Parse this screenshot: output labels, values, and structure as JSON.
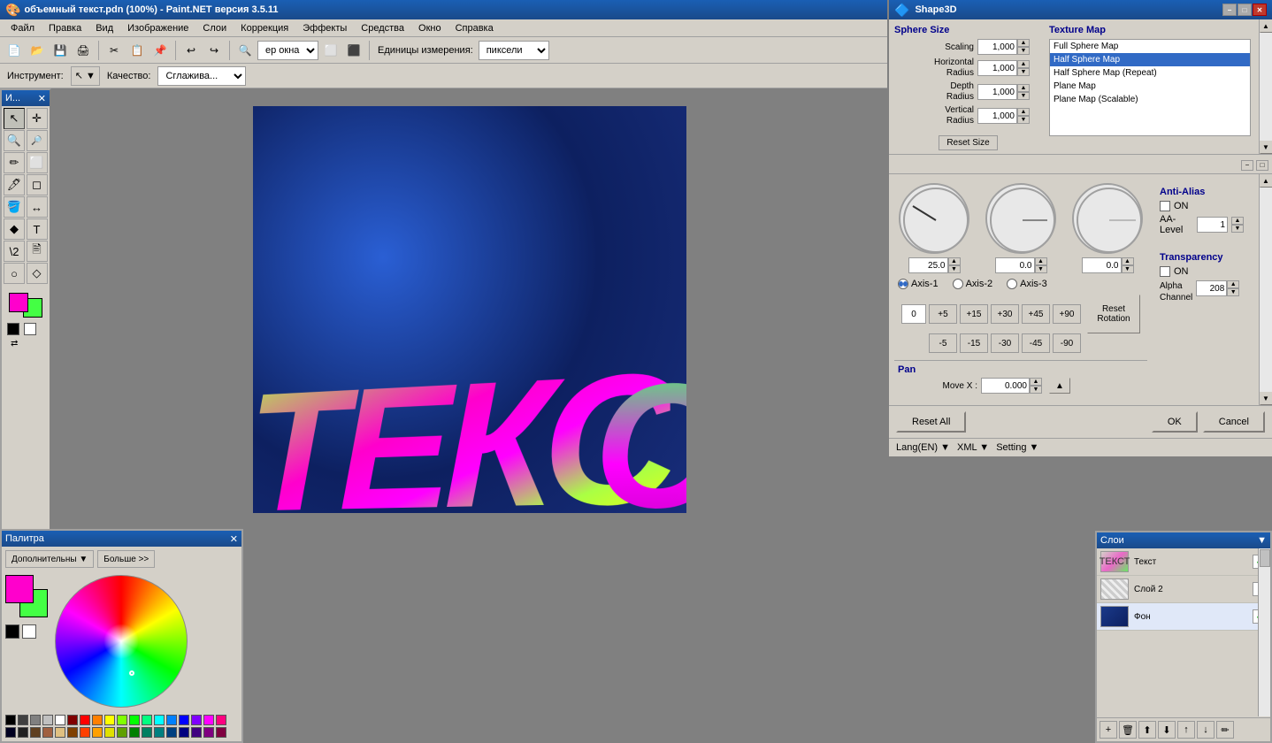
{
  "titleBar": {
    "title": "объемный текст.pdn (100%) - Paint.NET версия 3.5.11",
    "closeBtn": "✕",
    "minBtn": "−",
    "maxBtn": "□",
    "icon": "🎨"
  },
  "menuBar": {
    "items": [
      "Файл",
      "Правка",
      "Вид",
      "Изображение",
      "Слои",
      "Коррекция",
      "Эффекты",
      "Средства",
      "Окно",
      "Справка"
    ]
  },
  "toolbar": {
    "zoomLabel": "ер окна",
    "unitsLabel": "Единицы измерения:",
    "unitsValue": "пиксели"
  },
  "toolOptions": {
    "toolLabel": "Инструмент:",
    "qualityLabel": "Качество:",
    "qualityValue": "Сглажива..."
  },
  "shape3d": {
    "title": "Shape3D",
    "titleIcon": "🔷",
    "closeBtn": "✕",
    "minBtn": "−",
    "maxBtn": "□",
    "sphereSize": {
      "title": "Sphere Size",
      "fields": [
        {
          "label": "Scaling",
          "value": "1,000"
        },
        {
          "label": "Horizontal\nRadius",
          "value": "1,000"
        },
        {
          "label": "Depth\nRadius",
          "value": "1,000"
        },
        {
          "label": "Vertical\nRadius",
          "value": "1,000"
        }
      ],
      "resetBtn": "Reset Size"
    },
    "textureMap": {
      "title": "Texture Map",
      "items": [
        {
          "label": "Full Sphere Map",
          "selected": false
        },
        {
          "label": "Half Sphere Map",
          "selected": true
        },
        {
          "label": "Half Sphere Map (Repeat)",
          "selected": false
        },
        {
          "label": "Plane Map",
          "selected": false
        },
        {
          "label": "Plane Map (Scalable)",
          "selected": false
        }
      ]
    },
    "rotation": {
      "subPanelMinBtn": "−",
      "subPanelMaxBtn": "□",
      "dial1Value": "25.0",
      "dial2Value": "0.0",
      "dial3Value": "0.0",
      "dial1Angle": -30,
      "dial2Angle": 0,
      "dial3Angle": 0,
      "axes": [
        {
          "label": "Axis-1",
          "active": true
        },
        {
          "label": "Axis-2",
          "active": false
        },
        {
          "label": "Axis-3",
          "active": false
        }
      ],
      "stepVal": "0",
      "steps": [
        "+5",
        "+15",
        "+30",
        "+45",
        "+90",
        "-5",
        "-15",
        "-30",
        "-45",
        "-90"
      ],
      "resetBtn": "Reset\nRotation"
    },
    "antiAlias": {
      "title": "Anti-Alias",
      "onLabel": "ON",
      "aaLevelLabel": "AA-Level",
      "aaLevelValue": "1"
    },
    "transparency": {
      "title": "Transparency",
      "onLabel": "ON",
      "alphaChannelLabel": "Alpha\nChannel",
      "alphaValue": "208"
    },
    "pan": {
      "title": "Pan",
      "moveXLabel": "Move X :",
      "moveXValue": "0.000"
    },
    "resetAllBtn": "Reset All",
    "okBtn": "OK",
    "cancelBtn": "Cancel",
    "langBar": {
      "lang": "Lang(EN)",
      "xml": "XML",
      "setting": "Setting"
    }
  },
  "toolbox": {
    "title": "И...",
    "closeIcon": "✕",
    "tools": [
      "↖",
      "✛",
      "🔍",
      "🔎",
      "✏",
      "⬜",
      "🖊",
      "✒",
      "🪣",
      "↔",
      "🔷",
      "T",
      "\\2",
      "○",
      "◇"
    ]
  },
  "palette": {
    "title": "Палитра",
    "closeIcon": "✕",
    "dropdownBtn": "Дополнительны",
    "moreBtn": "Больше >>",
    "colors": [
      "#000000",
      "#ffffff",
      "#808080",
      "#c0c0c0",
      "#ff0000",
      "#800000",
      "#ffff00",
      "#808000",
      "#00ff00",
      "#008000",
      "#00ffff",
      "#008080",
      "#0000ff",
      "#000080",
      "#ff00ff",
      "#800080",
      "#ff8000",
      "#804000",
      "#804080",
      "#ff80c0"
    ]
  },
  "canvas": {
    "text": "ТЕКСO"
  },
  "layers": {
    "items": [
      {
        "name": "Текст",
        "visible": true,
        "type": "text"
      },
      {
        "name": "Слой 2",
        "visible": false,
        "type": "layer2"
      },
      {
        "name": "Фон",
        "visible": true,
        "type": "background"
      }
    ],
    "toolBtns": [
      "+",
      "🗑",
      "⬆",
      "⬇",
      "↑",
      "↓",
      "✏"
    ]
  }
}
